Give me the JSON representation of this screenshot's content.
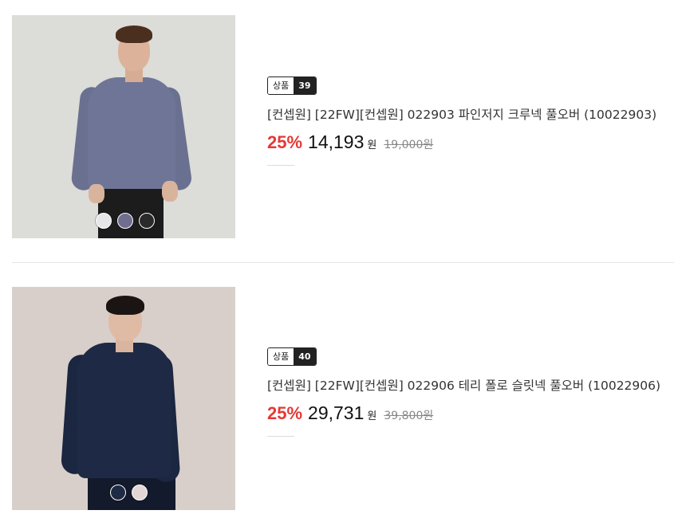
{
  "products": [
    {
      "badge_label": "상품",
      "badge_number": "39",
      "title": "[컨셉원] [22FW][컨셉원] 022903 파인저지 크루넥 풀오버 (10022903)",
      "discount": "25%",
      "price": "14,193",
      "currency": "원",
      "original_price": "19,000원",
      "swatches": [
        "#e6e6e8",
        "#6f6e8f",
        "#2a2a2a"
      ],
      "garment_color": "#6f7596"
    },
    {
      "badge_label": "상품",
      "badge_number": "40",
      "title": "[컨셉원] [22FW][컨셉원] 022906 테리 폴로 슬릿넥 풀오버 (10022906)",
      "discount": "25%",
      "price": "29,731",
      "currency": "원",
      "original_price": "39,800원",
      "swatches": [
        "#1f2a44",
        "#e3d6d4"
      ],
      "garment_color": "#1e2a45"
    }
  ]
}
